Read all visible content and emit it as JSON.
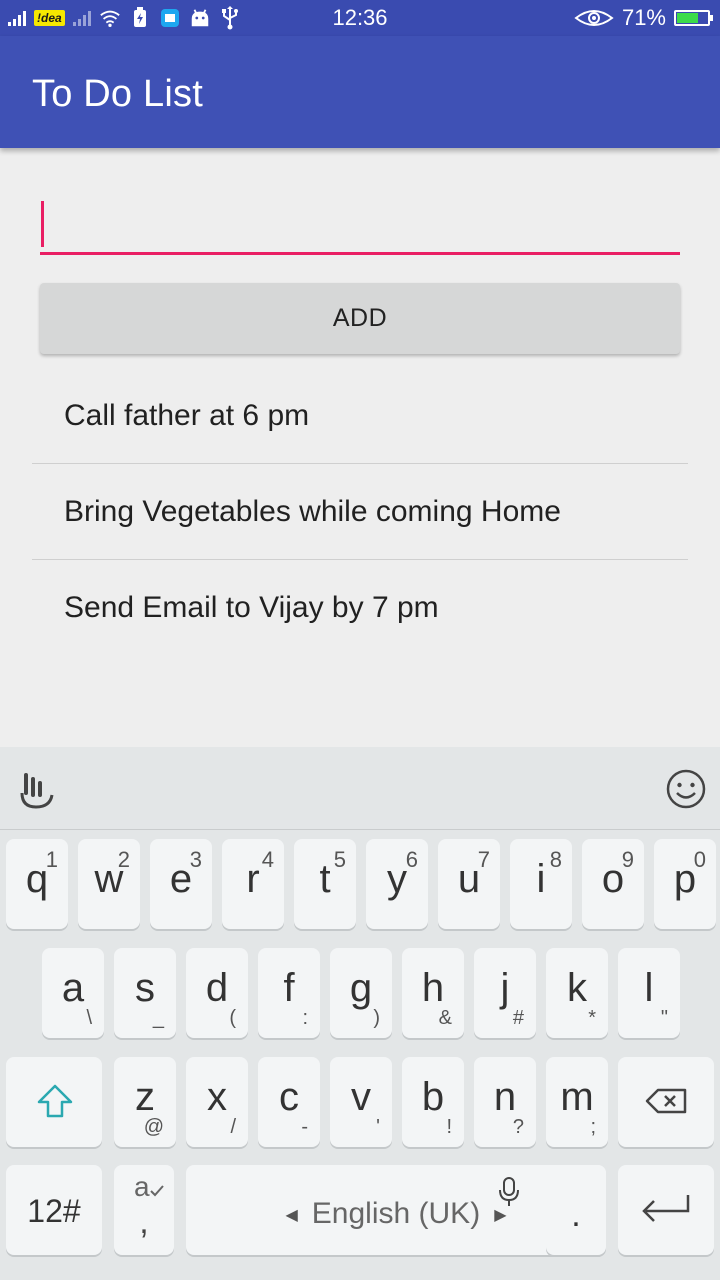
{
  "status_bar": {
    "carrier": "!dea",
    "time": "12:36",
    "battery": "71%",
    "battery_level": 0.71
  },
  "app_bar": {
    "title": "To Do List"
  },
  "form": {
    "input_value": "",
    "add_label": "ADD"
  },
  "todos": [
    "Call father at 6 pm",
    "Bring Vegetables while coming Home",
    "Send Email to Vijay by 7 pm"
  ],
  "keyboard": {
    "row1": [
      {
        "k": "q",
        "h": "1"
      },
      {
        "k": "w",
        "h": "2"
      },
      {
        "k": "e",
        "h": "3"
      },
      {
        "k": "r",
        "h": "4"
      },
      {
        "k": "t",
        "h": "5"
      },
      {
        "k": "y",
        "h": "6"
      },
      {
        "k": "u",
        "h": "7"
      },
      {
        "k": "i",
        "h": "8"
      },
      {
        "k": "o",
        "h": "9"
      },
      {
        "k": "p",
        "h": "0"
      }
    ],
    "row2": [
      {
        "k": "a",
        "s": "\\"
      },
      {
        "k": "s",
        "s": "_"
      },
      {
        "k": "d",
        "s": "("
      },
      {
        "k": "f",
        "s": ":"
      },
      {
        "k": "g",
        "s": ")"
      },
      {
        "k": "h",
        "s": "&"
      },
      {
        "k": "j",
        "s": "#"
      },
      {
        "k": "k",
        "s": "*"
      },
      {
        "k": "l",
        "s": "\""
      }
    ],
    "row3": [
      {
        "k": "z",
        "s": "@"
      },
      {
        "k": "x",
        "s": "/"
      },
      {
        "k": "c",
        "s": "-"
      },
      {
        "k": "v",
        "s": "'"
      },
      {
        "k": "b",
        "s": "!"
      },
      {
        "k": "n",
        "s": "?"
      },
      {
        "k": "m",
        "s": ";"
      }
    ],
    "numbers_key": "12#",
    "comma_key": ",",
    "comma_hint": "a",
    "space_label": "English (UK)",
    "period_key": "."
  }
}
